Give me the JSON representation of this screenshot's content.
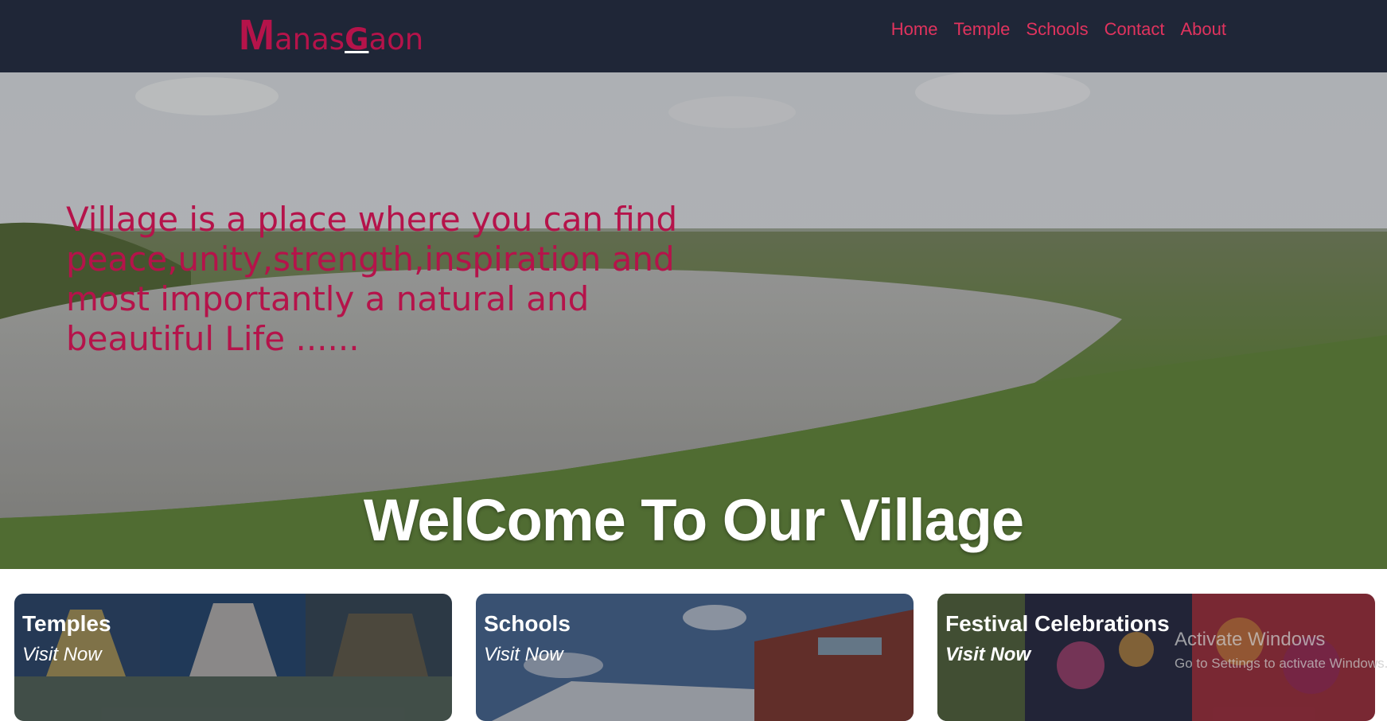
{
  "nav": {
    "brand_first": "M",
    "brand_mid": "anas",
    "brand_g": "G",
    "brand_end": "aon",
    "links": [
      "Home",
      "Temple",
      "Schools",
      "Contact",
      "About"
    ]
  },
  "hero": {
    "quote": "Village is a place where you can find peace,unity,strength,inspiration and most importantly a natural and beautiful Life ......",
    "title": "WelCome To Our Village"
  },
  "cards": [
    {
      "title": "Temples",
      "link": "Visit Now"
    },
    {
      "title": "Schools",
      "link": "Visit Now"
    },
    {
      "title": "Festival Celebrations",
      "link": "Visit Now"
    }
  ],
  "watermark": {
    "line1": "Activate Windows",
    "line2": "Go to Settings to activate Windows."
  },
  "colors": {
    "navbar_bg": "#1f2637",
    "brand": "#b5134a",
    "nav_link": "#e1335e",
    "hero_quote": "#b5134a"
  }
}
